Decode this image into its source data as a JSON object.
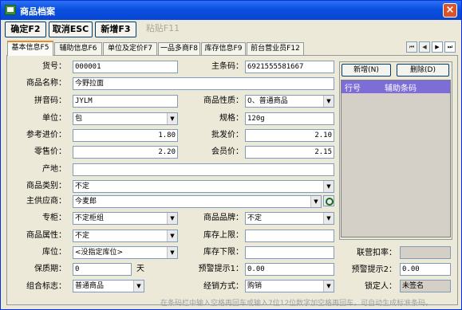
{
  "window": {
    "title": "商品档案",
    "close_label": "×"
  },
  "toolbar": {
    "confirm": "确定F2",
    "cancel": "取消ESC",
    "add": "新增F3",
    "paste": "粘贴F11"
  },
  "tabs": [
    "基本信息F5",
    "辅助信息F6",
    "单位及定价F7",
    "一品多商F8",
    "库存信息F9",
    "前台营业员F12"
  ],
  "nav": [
    "⏮",
    "◀",
    "▶",
    "⏭"
  ],
  "form": {
    "goods_no": {
      "label": "货号：",
      "value": "000001"
    },
    "barcode": {
      "label": "主条码：",
      "value": "6921555581667"
    },
    "name": {
      "label": "商品名称：",
      "value": "今野拉面"
    },
    "pinyin": {
      "label": "拼音码：",
      "value": "JYLM"
    },
    "nature": {
      "label": "商品性质：",
      "value": "0、普通商品"
    },
    "unit": {
      "label": "单位：",
      "value": "包"
    },
    "spec": {
      "label": "规格：",
      "value": "120g"
    },
    "ref_price": {
      "label": "参考进价：",
      "value": "1.80"
    },
    "wholesale": {
      "label": "批发价：",
      "value": "2.10"
    },
    "retail": {
      "label": "零售价：",
      "value": "2.20"
    },
    "member_price": {
      "label": "会员价：",
      "value": "2.15"
    },
    "origin": {
      "label": "产地：",
      "value": ""
    },
    "category": {
      "label": "商品类别：",
      "value": "不定"
    },
    "supplier": {
      "label": "主供应商：",
      "value": "今麦郎"
    },
    "counter": {
      "label": "专柜：",
      "value": "不定柜组"
    },
    "brand": {
      "label": "商品品牌：",
      "value": "不定"
    },
    "attribute": {
      "label": "商品属性：",
      "value": "不定"
    },
    "stock_upper": {
      "label": "库存上限：",
      "value": ""
    },
    "location": {
      "label": "库位：",
      "value": "<没指定库位>"
    },
    "stock_lower": {
      "label": "库存下限：",
      "value": ""
    },
    "shelf_life": {
      "label": "保质期：",
      "value": "0",
      "unit": "天"
    },
    "warn1": {
      "label": "预警提示1：",
      "value": "0.00"
    },
    "combo": {
      "label": "组合标志：",
      "value": "普通商品"
    },
    "mode": {
      "label": "经销方式：",
      "value": "购销"
    },
    "discount": {
      "label": "联营扣率：",
      "value": ""
    },
    "warn2": {
      "label": "预警提示2：",
      "value": "0.00"
    },
    "locker": {
      "label": "锁定人：",
      "value": "未签名"
    }
  },
  "aux_barcode": {
    "add_button": "新增(N)",
    "delete_button": "删除(D)",
    "col_line": "行号",
    "col_barcode": "辅助条码"
  },
  "status_text": "在条码栏中输入空格再回车或输入7位12位数字加空格再回车，可自动生成标准条码。"
}
